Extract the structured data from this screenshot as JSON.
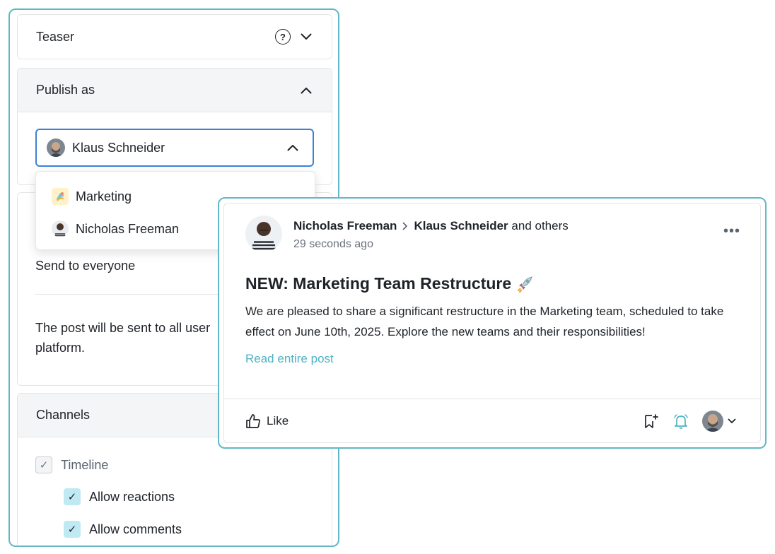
{
  "settings": {
    "teaser": {
      "title": "Teaser"
    },
    "publish_as": {
      "title": "Publish as",
      "selected": "Klaus Schneider",
      "options": [
        {
          "label": "Marketing",
          "icon": "marketing-icon"
        },
        {
          "label": "Nicholas Freeman",
          "icon": "avatar"
        }
      ]
    },
    "audience": {
      "value": "Send to everyone",
      "description": "The post will be sent to all user\nplatform."
    },
    "channels": {
      "title": "Channels",
      "timeline": {
        "label": "Timeline",
        "checked": true
      },
      "allow_reactions": {
        "label": "Allow reactions",
        "checked": true
      },
      "allow_comments": {
        "label": "Allow comments",
        "checked": true
      }
    }
  },
  "post": {
    "author": "Nicholas Freeman",
    "target": "Klaus Schneider",
    "others": "and others",
    "time": "29 seconds ago",
    "title": "NEW: Marketing Team Restructure",
    "body": "We are pleased to share a significant restructure in the Marketing team, scheduled to take effect on June 10th, 2025. Explore the new teams and their responsibilities!",
    "read_more": "Read entire post",
    "like_label": "Like",
    "more_label": "•••"
  },
  "colors": {
    "frame": "#62b8c6",
    "select_border": "#3b82d6",
    "link": "#4fb3c4",
    "checkbox_fill": "#bfeaf3"
  }
}
